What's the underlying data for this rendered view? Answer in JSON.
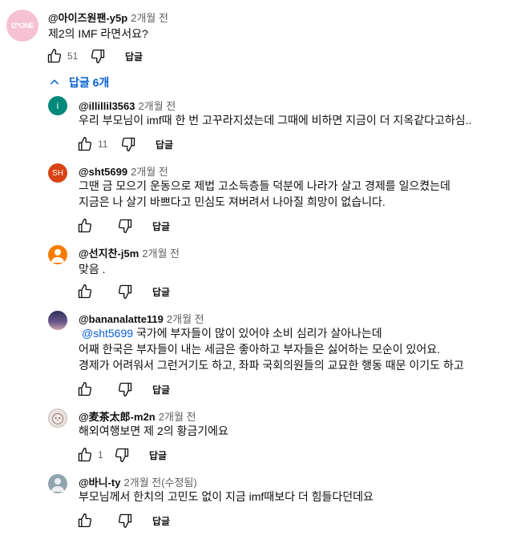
{
  "top_comment": {
    "author": "@아이즈원팬-y5p",
    "time": "2개월 전",
    "text": "제2의 IMF 라면서요?",
    "likes": "51",
    "reply_label": "답글",
    "avatar_text": "IZ*ONE"
  },
  "replies_toggle": {
    "label": "답글 6개"
  },
  "replies": [
    {
      "author": "@illillil3563",
      "time": "2개월 전",
      "lines": [
        "우리 부모님이 imf때 한 번 고꾸라지셨는데 그때에 비하면 지금이 더 지옥같다고하심.."
      ],
      "likes": "11",
      "reply_label": "답글",
      "avatar_text": "i",
      "avatar_color": "#00897b"
    },
    {
      "author": "@sht5699",
      "time": "2개월 전",
      "lines": [
        "그땐 금 모으기 운동으로 제법 고소득층들 덕분에 나라가 살고 경제를 일으켰는데",
        "지금은 나 살기 바쁘다고 민심도 져버려서 나아질 희망이 없습니다."
      ],
      "likes": "",
      "reply_label": "답글",
      "avatar_text": "SH",
      "avatar_color": "#d84315"
    },
    {
      "author": "@선지찬-j5m",
      "time": "2개월 전",
      "lines": [
        "맞음 ."
      ],
      "likes": "",
      "reply_label": "답글",
      "avatar_text": "",
      "avatar_color": "#f57c00"
    },
    {
      "author": "@bananalatte119",
      "time": "2개월 전",
      "mention": "@sht5699",
      "first_line": "국가에 부자들이 많이 있어야 소비 심리가 살아나는데",
      "lines": [
        "어째 한국은 부자들이 내는 세금은 좋아하고 부자들은 싫어하는 모순이 있어요.",
        "경제가 어려워서 그런거기도 하고, 좌파 국회의원들의 교묘한 행동 때문 이기도 하고"
      ],
      "likes": "",
      "reply_label": "답글",
      "avatar_text": "",
      "avatar_color": "#3b3f6b"
    },
    {
      "author": "@麦茶太郎-m2n",
      "time": "2개월 전",
      "lines": [
        "해외여행보면 제 2의 황금기에요"
      ],
      "likes": "1",
      "reply_label": "답글",
      "avatar_text": "",
      "avatar_color": "#d7ccc8"
    },
    {
      "author": "@바니-ty",
      "time": "2개월 전(수정됨)",
      "lines": [
        "부모님께서 한치의 고민도 없이 지금 imf때보다 더 힘들다던데요"
      ],
      "likes": "",
      "reply_label": "답글",
      "avatar_text": "",
      "avatar_color": "#90a4ae"
    }
  ],
  "colors": {
    "text": "#0f0f0f",
    "secondary": "#606060",
    "link": "#065fd4",
    "avatar_top": "#f8bbd0"
  }
}
